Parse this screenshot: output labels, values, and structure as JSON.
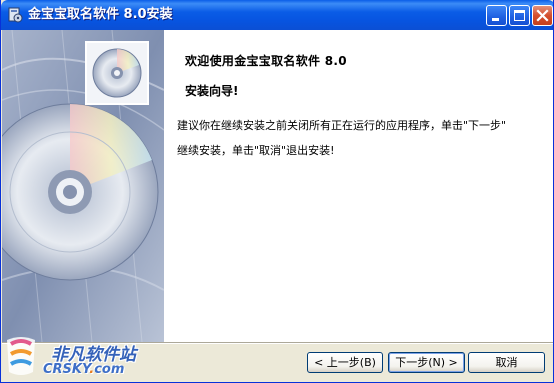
{
  "window": {
    "title": "金宝宝取名软件 8.0安装",
    "app_icon": "installer-icon"
  },
  "titlebar_buttons": {
    "minimize_icon": "minimize-icon",
    "maximize_icon": "maximize-icon",
    "close_icon": "close-icon"
  },
  "content": {
    "welcome": "欢迎使用金宝宝取名软件 8.0",
    "subtitle": "安装向导!",
    "line1": "建议你在继续安装之前关闭所有正在运行的应用程序，单击\"下一步\"",
    "line2": "继续安装，单击\"取消\"退出安装!"
  },
  "buttons": {
    "back_label": "< 上一步(B)",
    "next_label": "下一步(N) >",
    "cancel_label": "取消"
  },
  "watermark": {
    "cn": "非凡软件站",
    "en_main": "CRSKY",
    "en_dot": ".",
    "en_tld": "com"
  },
  "colors": {
    "titlebar": "#0A5CE6",
    "dialog_bg": "#ECE9D8",
    "close_button": "#D44F2E",
    "button_border": "#003C74"
  }
}
